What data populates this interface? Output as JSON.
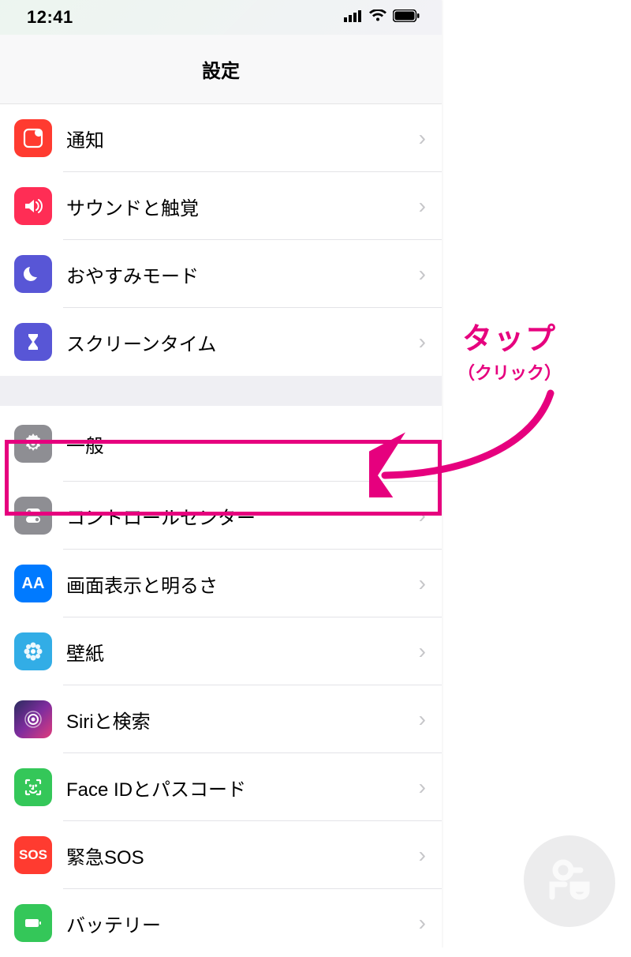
{
  "status": {
    "time": "12:41"
  },
  "nav": {
    "title": "設定"
  },
  "sections": [
    {
      "rows": [
        {
          "key": "notifications",
          "label": "通知",
          "icon": "notification-icon",
          "bg": "bg-red"
        },
        {
          "key": "sounds",
          "label": "サウンドと触覚",
          "icon": "speaker-icon",
          "bg": "bg-pink"
        },
        {
          "key": "dnd",
          "label": "おやすみモード",
          "icon": "moon-icon",
          "bg": "bg-purple"
        },
        {
          "key": "screentime",
          "label": "スクリーンタイム",
          "icon": "hourglass-icon",
          "bg": "bg-indigo"
        }
      ]
    },
    {
      "rows": [
        {
          "key": "general",
          "label": "一般",
          "icon": "gear-icon",
          "bg": "bg-gray",
          "highlighted": true
        },
        {
          "key": "control-center",
          "label": "コントロールセンター",
          "icon": "toggle-icon",
          "bg": "bg-gray"
        },
        {
          "key": "display",
          "label": "画面表示と明るさ",
          "icon": "aa-icon",
          "bg": "bg-blue"
        },
        {
          "key": "wallpaper",
          "label": "壁紙",
          "icon": "flower-icon",
          "bg": "bg-teal"
        },
        {
          "key": "siri",
          "label": "Siriと検索",
          "icon": "siri-icon",
          "bg": "bg-siri"
        },
        {
          "key": "faceid",
          "label": "Face IDとパスコード",
          "icon": "faceid-icon",
          "bg": "bg-green"
        },
        {
          "key": "sos",
          "label": "緊急SOS",
          "icon": "sos-icon",
          "bg": "bg-sos"
        },
        {
          "key": "battery",
          "label": "バッテリー",
          "icon": "battery-icon",
          "bg": "bg-green"
        }
      ]
    }
  ],
  "annotation": {
    "main": "タップ",
    "sub": "（クリック）"
  },
  "colors": {
    "accent": "#e6007e"
  }
}
